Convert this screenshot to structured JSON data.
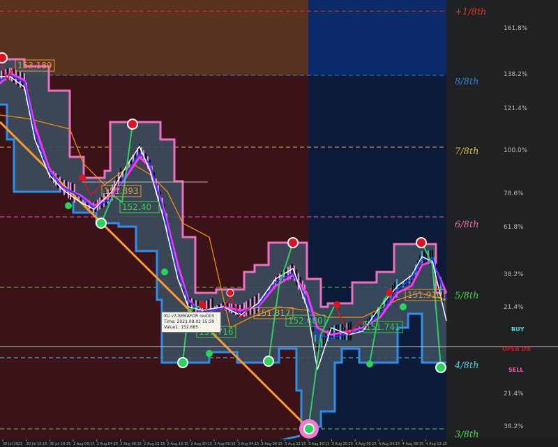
{
  "chart_data": {
    "type": "line",
    "grid": false,
    "murrey_levels": [
      {
        "label": "+1/8th",
        "pct": "161.8%",
        "color": "#e8302a"
      },
      {
        "label": "8/8th",
        "pct": "138.2%",
        "color": "#2f7fe0"
      },
      {
        "label": "",
        "pct": "121.4%",
        "color": "#bbbbbb"
      },
      {
        "label": "7/8th",
        "pct": "100.0%",
        "color": "#d9b84a"
      },
      {
        "label": "",
        "pct": "78.6%",
        "color": "#bbbbbb"
      },
      {
        "label": "6/8th",
        "pct": "61.8%",
        "color": "#e86aa0"
      },
      {
        "label": "",
        "pct": "38.2%",
        "color": "#bbbbbb"
      },
      {
        "label": "5/8th",
        "pct": "",
        "color": "#4fd24f"
      },
      {
        "label": "",
        "pct": "21.4%",
        "color": "#bbbbbb"
      },
      {
        "label": "4/8th",
        "pct": "",
        "color": "#4fd3e0"
      },
      {
        "label": "",
        "pct": "21.4%",
        "color": "#bbbbbb"
      },
      {
        "label": "3/8th",
        "pct": "",
        "color": "#4fd24f"
      },
      {
        "label": "",
        "pct": "38.2%",
        "color": "#bbbbbb"
      }
    ],
    "price_labels": [
      {
        "text": "153.189",
        "color": "#e39a3a"
      },
      {
        "text": "151.893",
        "color": "#e39a3a"
      },
      {
        "text": "152.40",
        "color": "#38d14a"
      },
      {
        "text": "151.817",
        "color": "#e39a3a"
      },
      {
        "text": "152.080",
        "color": "#38d14a"
      },
      {
        "text": "151.716",
        "color": "#38d14a"
      },
      {
        "text": "151.741",
        "color": "#38d14a"
      },
      {
        "text": "151.910",
        "color": "#e39a3a"
      }
    ],
    "buy_label": "BUY",
    "open_label": "OPEN DN",
    "sell_label": "SELL",
    "x_ticks": [
      "30 Jul 2021",
      "30 Jul 16:15",
      "30 Jul 20:15",
      "2 Aug 00:15",
      "2 Aug 04:15",
      "2 Aug 08:15",
      "2 Aug 12:15",
      "2 Aug 16:15",
      "2 Aug 20:15",
      "3 Aug 00:15",
      "3 Aug 04:15",
      "3 Aug 08:15",
      "3 Aug 12:15",
      "3 Aug 16:15",
      "3 Aug 20:15",
      "4 Aug 00:15",
      "4 Aug 04:15",
      "4 Aug 08:15",
      "4 Aug 12:15"
    ],
    "colors": {
      "zone_red": "#3a1218",
      "zone_navy": "#0d1a3a",
      "zone_orange": "#5a3220",
      "zone_blue": "#0a2a6a",
      "band_fill": "#3c4d5e",
      "upper_band": "#f070c0",
      "lower_band": "#2e8fe8",
      "ma_magenta": "#ff38e0",
      "ma_blue": "#1e3cff",
      "ma_white": "#ffffff",
      "ma_orange": "#ff8c00",
      "trend": "#ff9a2e",
      "signal_green": "#2ad45a",
      "signal_red": "#e01020"
    }
  },
  "tooltip": {
    "line1": "XU v7-SEMAFOR rev003",
    "line2": "Time: 2021.08.02 15:30",
    "line3": "Value1: 152.685"
  }
}
